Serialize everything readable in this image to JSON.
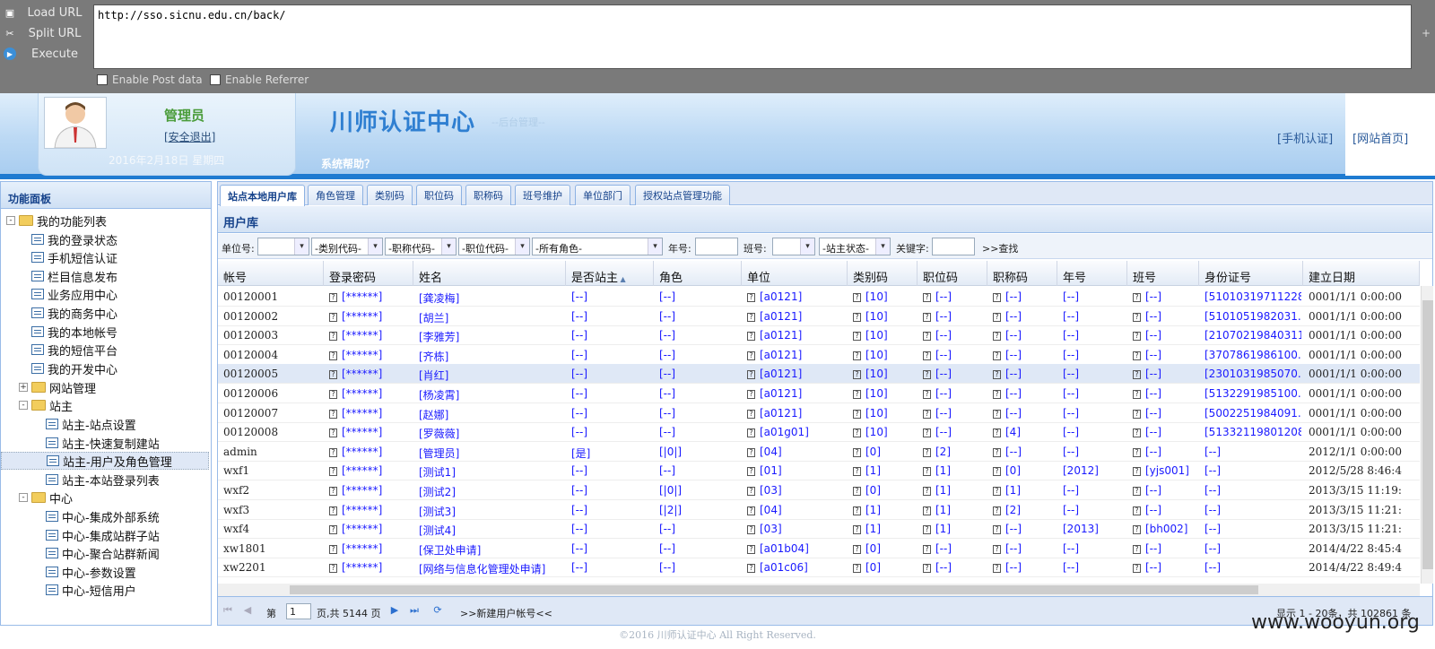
{
  "hackbar": {
    "buttons": [
      "Load URL",
      "Split URL",
      "Execute"
    ],
    "url": "http://sso.sicnu.edu.cn/back/",
    "options": [
      "Enable Post data",
      "Enable Referrer"
    ],
    "plus": "+"
  },
  "header": {
    "admin_name": "管理员",
    "logout": "[安全退出]",
    "date": "2016年2月18日 星期四",
    "site_title": "川师认证中心",
    "site_subtitle": "--后台管理--",
    "help": "系统帮助？",
    "mobile_link": "[手机认证]",
    "home_link": "[网站首页]"
  },
  "sidebar": {
    "title": "功能面板",
    "items": [
      "我的功能列表",
      "我的登录状态",
      "手机短信认证",
      "栏目信息发布",
      "业务应用中心",
      "我的商务中心",
      "我的本地帐号",
      "我的短信平台",
      "我的开发中心",
      "网站管理",
      "站主",
      "站主-站点设置",
      "站主-快速复制建站",
      "站主-用户及角色管理",
      "站主-本站登录列表",
      "中心",
      "中心-集成外部系统",
      "中心-集成站群子站",
      "中心-聚合站群新闻",
      "中心-参数设置",
      "中心-短信用户"
    ]
  },
  "tabs": [
    "站点本地用户库",
    "角色管理",
    "类别码",
    "职位码",
    "职称码",
    "班号维护",
    "单位部门",
    "授权站点管理功能"
  ],
  "panel_title": "用户库",
  "filters": {
    "unit_label": "单位号:",
    "category": "-类别代码-",
    "title_code": "-职称代码-",
    "position": "-职位代码-",
    "role": "-所有角色-",
    "year_label": "年号:",
    "class_label": "班号:",
    "status": "-站主状态-",
    "keyword_label": "关键字:",
    "search": ">>查找"
  },
  "columns": [
    "帐号",
    "登录密码",
    "姓名",
    "是否站主",
    "角色",
    "单位",
    "类别码",
    "职位码",
    "职称码",
    "年号",
    "班号",
    "身份证号",
    "建立日期"
  ],
  "rows": [
    [
      "00120001",
      "[******]",
      "[龚凌梅]",
      "[--]",
      "[--]",
      "[a0121]",
      "[10]",
      "[--]",
      "[--]",
      "[--]",
      "[--]",
      "[51010319711228...",
      "0001/1/1 0:00:00"
    ],
    [
      "00120002",
      "[******]",
      "[胡兰]",
      "[--]",
      "[--]",
      "[a0121]",
      "[10]",
      "[--]",
      "[--]",
      "[--]",
      "[--]",
      "[5101051982031...",
      "0001/1/1 0:00:00"
    ],
    [
      "00120003",
      "[******]",
      "[李雅芳]",
      "[--]",
      "[--]",
      "[a0121]",
      "[10]",
      "[--]",
      "[--]",
      "[--]",
      "[--]",
      "[21070219840311...",
      "0001/1/1 0:00:00"
    ],
    [
      "00120004",
      "[******]",
      "[齐栋]",
      "[--]",
      "[--]",
      "[a0121]",
      "[10]",
      "[--]",
      "[--]",
      "[--]",
      "[--]",
      "[3707861986100...",
      "0001/1/1 0:00:00"
    ],
    [
      "00120005",
      "[******]",
      "[肖红]",
      "[--]",
      "[--]",
      "[a0121]",
      "[10]",
      "[--]",
      "[--]",
      "[--]",
      "[--]",
      "[2301031985070...",
      "0001/1/1 0:00:00"
    ],
    [
      "00120006",
      "[******]",
      "[杨凌霄]",
      "[--]",
      "[--]",
      "[a0121]",
      "[10]",
      "[--]",
      "[--]",
      "[--]",
      "[--]",
      "[5132291985100...",
      "0001/1/1 0:00:00"
    ],
    [
      "00120007",
      "[******]",
      "[赵娜]",
      "[--]",
      "[--]",
      "[a0121]",
      "[10]",
      "[--]",
      "[--]",
      "[--]",
      "[--]",
      "[5002251984091...",
      "0001/1/1 0:00:00"
    ],
    [
      "00120008",
      "[******]",
      "[罗薇薇]",
      "[--]",
      "[--]",
      "[a01g01]",
      "[10]",
      "[--]",
      "[4]",
      "[--]",
      "[--]",
      "[51332119801208...",
      "0001/1/1 0:00:00"
    ],
    [
      "admin",
      "[******]",
      "[管理员]",
      "[是]",
      "[|0|]",
      "[04]",
      "[0]",
      "[2]",
      "[--]",
      "[--]",
      "[--]",
      "[--]",
      "2012/1/1 0:00:00"
    ],
    [
      "wxf1",
      "[******]",
      "[测试1]",
      "[--]",
      "[--]",
      "[01]",
      "[1]",
      "[1]",
      "[0]",
      "[2012]",
      "[yjs001]",
      "[--]",
      "2012/5/28 8:46:4"
    ],
    [
      "wxf2",
      "[******]",
      "[测试2]",
      "[--]",
      "[|0|]",
      "[03]",
      "[0]",
      "[1]",
      "[1]",
      "[--]",
      "[--]",
      "[--]",
      "2013/3/15 11:19:"
    ],
    [
      "wxf3",
      "[******]",
      "[测试3]",
      "[--]",
      "[|2|]",
      "[04]",
      "[1]",
      "[1]",
      "[2]",
      "[--]",
      "[--]",
      "[--]",
      "2013/3/15 11:21:"
    ],
    [
      "wxf4",
      "[******]",
      "[测试4]",
      "[--]",
      "[--]",
      "[03]",
      "[1]",
      "[1]",
      "[--]",
      "[2013]",
      "[bh002]",
      "[--]",
      "2013/3/15 11:21:"
    ],
    [
      "xw1801",
      "[******]",
      "[保卫处申请]",
      "[--]",
      "[--]",
      "[a01b04]",
      "[0]",
      "[--]",
      "[--]",
      "[--]",
      "[--]",
      "[--]",
      "2014/4/22 8:45:4"
    ],
    [
      "xw2201",
      "[******]",
      "[网络与信息化管理处申请]",
      "[--]",
      "[--]",
      "[a01c06]",
      "[0]",
      "[--]",
      "[--]",
      "[--]",
      "[--]",
      "[--]",
      "2014/4/22 8:49:4"
    ]
  ],
  "pager": {
    "page_label": "第",
    "page": "1",
    "total": "页,共 5144 页",
    "new_account": ">>新建用户帐号<<",
    "summary": "显示 1 - 20条，共 102861 条"
  },
  "footer": "©2016 川师认证中心  All Right Reserved.",
  "watermark": "www.wooyun.org"
}
